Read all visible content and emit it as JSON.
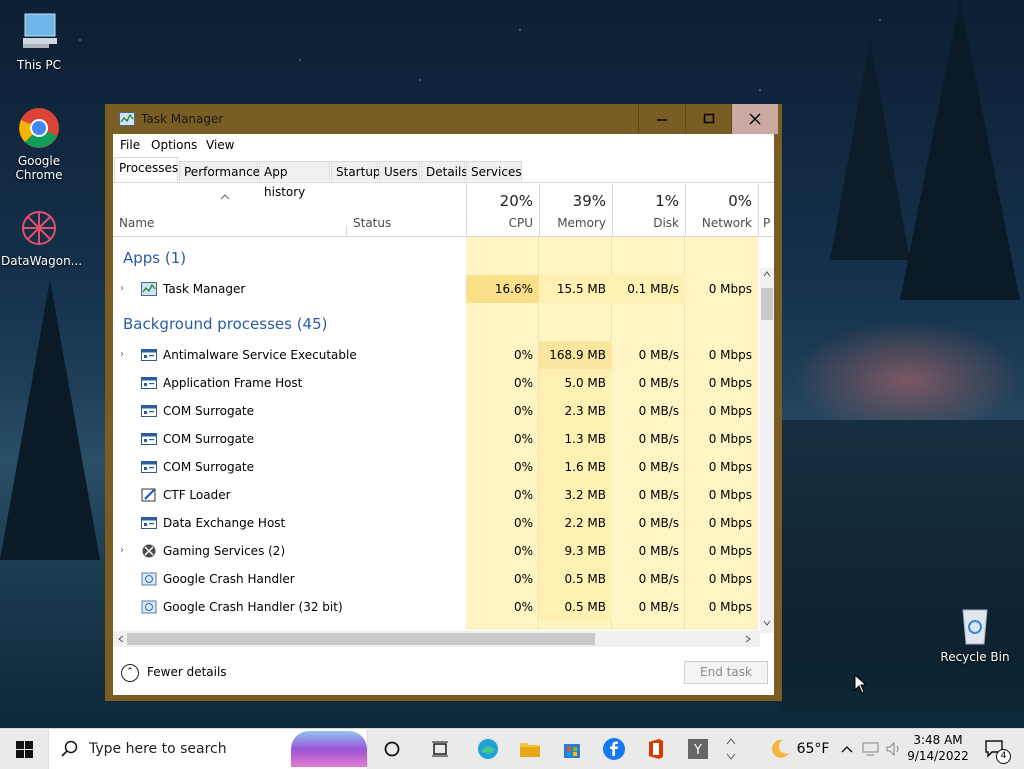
{
  "desktop": {
    "icons": [
      {
        "label": "This PC",
        "icon": "this-pc-icon"
      },
      {
        "label": "Google Chrome",
        "icon": "chrome-icon"
      },
      {
        "label": "DataWagon...",
        "icon": "datawagon-icon"
      },
      {
        "label": "Recycle Bin",
        "icon": "recycle-bin-icon"
      }
    ]
  },
  "window": {
    "title": "Task Manager",
    "menu": [
      "File",
      "Options",
      "View"
    ],
    "tabs": [
      "Processes",
      "Performance",
      "App history",
      "Startup",
      "Users",
      "Details",
      "Services"
    ],
    "active_tab": "Processes",
    "columns": {
      "name": "Name",
      "status": "Status",
      "cpu": {
        "pct": "20%",
        "label": "CPU"
      },
      "memory": {
        "pct": "39%",
        "label": "Memory"
      },
      "disk": {
        "pct": "1%",
        "label": "Disk"
      },
      "network": {
        "pct": "0%",
        "label": "Network"
      },
      "more": "P"
    },
    "groups": {
      "apps": "Apps (1)",
      "background": "Background processes (45)"
    },
    "apps": [
      {
        "name": "Task Manager",
        "cpu": "16.6%",
        "memory": "15.5 MB",
        "disk": "0.1 MB/s",
        "network": "0 Mbps"
      }
    ],
    "background": [
      {
        "name": "Antimalware Service Executable",
        "cpu": "0%",
        "memory": "168.9 MB",
        "disk": "0 MB/s",
        "network": "0 Mbps"
      },
      {
        "name": "Application Frame Host",
        "cpu": "0%",
        "memory": "5.0 MB",
        "disk": "0 MB/s",
        "network": "0 Mbps"
      },
      {
        "name": "COM Surrogate",
        "cpu": "0%",
        "memory": "2.3 MB",
        "disk": "0 MB/s",
        "network": "0 Mbps"
      },
      {
        "name": "COM Surrogate",
        "cpu": "0%",
        "memory": "1.3 MB",
        "disk": "0 MB/s",
        "network": "0 Mbps"
      },
      {
        "name": "COM Surrogate",
        "cpu": "0%",
        "memory": "1.6 MB",
        "disk": "0 MB/s",
        "network": "0 Mbps"
      },
      {
        "name": "CTF Loader",
        "cpu": "0%",
        "memory": "3.2 MB",
        "disk": "0 MB/s",
        "network": "0 Mbps"
      },
      {
        "name": "Data Exchange Host",
        "cpu": "0%",
        "memory": "2.2 MB",
        "disk": "0 MB/s",
        "network": "0 Mbps"
      },
      {
        "name": "Gaming Services (2)",
        "cpu": "0%",
        "memory": "9.3 MB",
        "disk": "0 MB/s",
        "network": "0 Mbps"
      },
      {
        "name": "Google Crash Handler",
        "cpu": "0%",
        "memory": "0.5 MB",
        "disk": "0 MB/s",
        "network": "0 Mbps"
      },
      {
        "name": "Google Crash Handler (32 bit)",
        "cpu": "0%",
        "memory": "0.5 MB",
        "disk": "0 MB/s",
        "network": "0 Mbps"
      }
    ],
    "footer": {
      "fewer_details": "Fewer details",
      "end_task": "End task"
    }
  },
  "taskbar": {
    "search_placeholder": "Type here to search",
    "weather": "65°F",
    "time": "3:48 AM",
    "date": "9/14/2022",
    "notification_count": "4"
  },
  "colors": {
    "window_border": "#7a5d22",
    "heat_cpu_high": "#fbe08a",
    "heat_light": "#fff4c4",
    "group_text": "#2a5aa8"
  }
}
